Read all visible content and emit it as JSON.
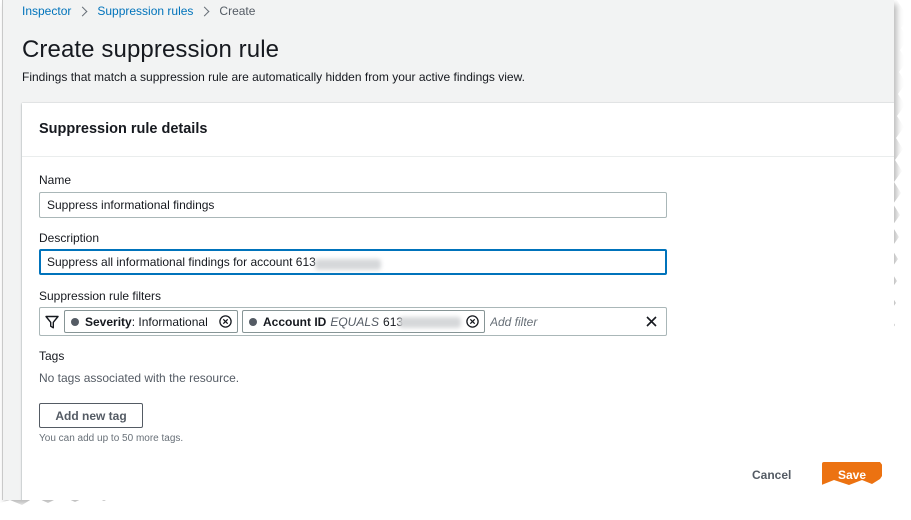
{
  "breadcrumb": {
    "items": [
      {
        "label": "Inspector"
      },
      {
        "label": "Suppression rules"
      },
      {
        "label": "Create"
      }
    ]
  },
  "page": {
    "title": "Create suppression rule",
    "description": "Findings that match a suppression rule are automatically hidden from your active findings view."
  },
  "panel": {
    "title": "Suppression rule details"
  },
  "form": {
    "name_label": "Name",
    "name_value": "Suppress informational findings",
    "description_label": "Description",
    "description_value": "Suppress all informational findings for account 613",
    "filters_label": "Suppression rule filters",
    "filters": [
      {
        "key": "Severity",
        "separator": ": ",
        "operator": "",
        "value": "Informational"
      },
      {
        "key": "Account ID",
        "separator": "",
        "operator": "EQUALS",
        "value": "613"
      }
    ],
    "add_filter_placeholder": "Add filter",
    "tags_label": "Tags",
    "no_tags_text": "No tags associated with the resource.",
    "add_tag_button": "Add new tag",
    "tags_hint": "You can add up to 50 more tags."
  },
  "actions": {
    "cancel_label": "Cancel",
    "save_label": "Save"
  },
  "colors": {
    "link": "#0073bb",
    "primary_button": "#ec7211",
    "focus_border": "#0073bb",
    "page_background": "#f2f3f3"
  },
  "icons": [
    "chevron-right-icon",
    "funnel-icon",
    "status-dot-icon",
    "remove-token-icon",
    "clear-filters-icon"
  ]
}
